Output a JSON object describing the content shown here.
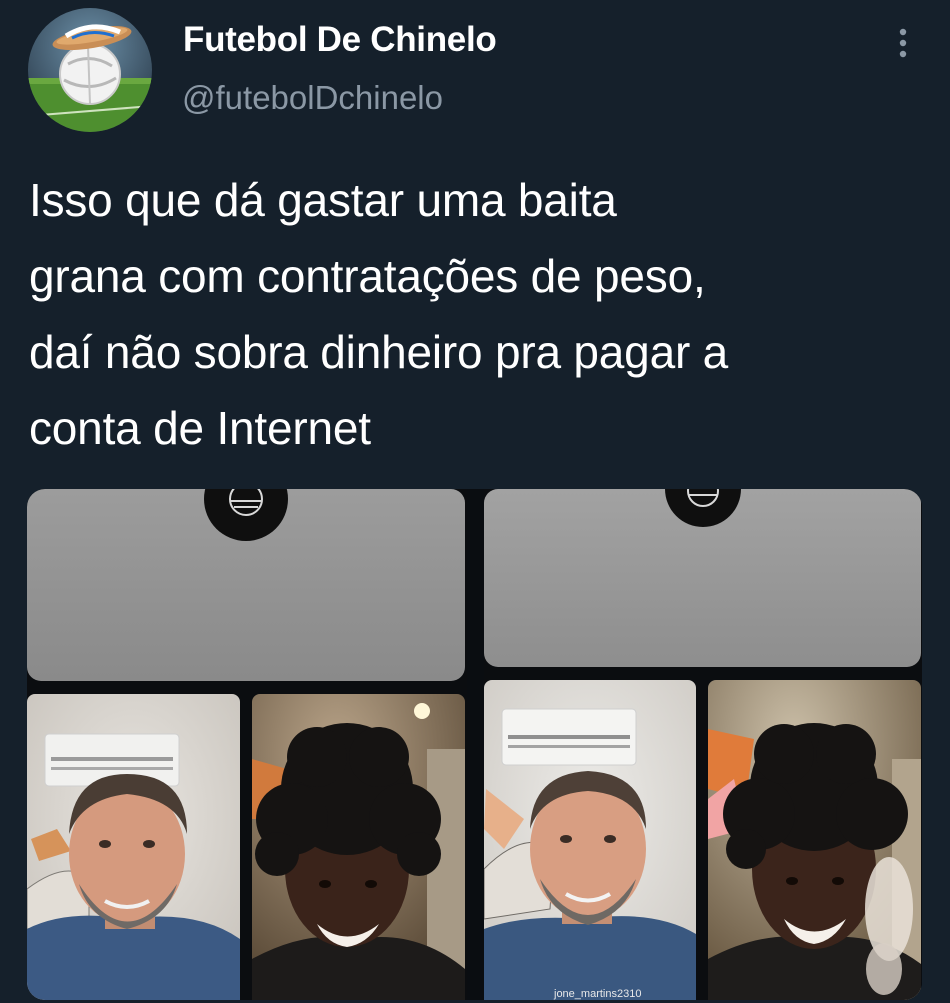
{
  "tweet": {
    "author": {
      "display_name": "Futebol De Chinelo",
      "handle": "@futebolDchinelo",
      "avatar_icon": "avatar-soccer-ball-sandal"
    },
    "text": "Isso que dá gastar uma baita\ngrana com contratações de peso,\ndaí não sobra dinheiro pra pagar a\nconta de Internet",
    "more_icon": "more-vertical-icon",
    "media": {
      "images": [
        {
          "name": "video-call-screenshot-1",
          "icon": "club-crest-icon"
        },
        {
          "name": "video-call-screenshot-2",
          "icon": "club-crest-icon",
          "caption": "jone_martins2310"
        }
      ]
    }
  },
  "colors": {
    "background": "#15202b",
    "text_primary": "#ffffff",
    "text_secondary": "#8b98a5"
  }
}
